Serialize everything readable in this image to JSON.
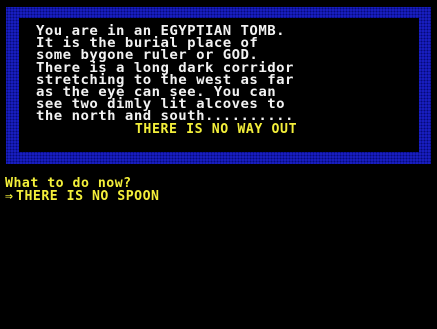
{
  "room": {
    "description_lines": [
      "You are in an EGYPTIAN TOMB.",
      "It is the burial place of",
      "some bygone ruler or GOD.",
      "There is a long dark corridor",
      "stretching to the west as far",
      "as the eye can see. You can",
      "see two dimly lit alcoves to",
      "the north and south.........."
    ],
    "exits": "THERE IS NO WAY OUT"
  },
  "console": {
    "prompt": "What to do now?",
    "cursor_icon": "arrow-right-icon",
    "input": "THERE IS NO SPOON"
  },
  "colors": {
    "background": "#000000",
    "border": "#1a20c8",
    "description_text": "#f2f2f2",
    "highlight_text": "#f3ef3a"
  }
}
